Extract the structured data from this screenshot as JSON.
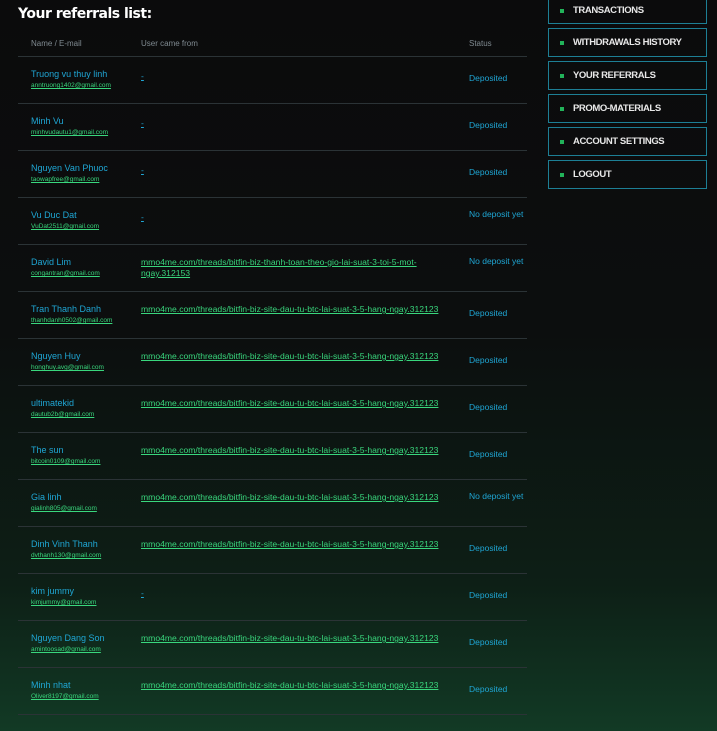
{
  "title": "Your referrals list:",
  "columns": {
    "name": "Name / E-mail",
    "source": "User came from",
    "status": "Status"
  },
  "rows": [
    {
      "name": "Truong vu thuy linh",
      "email": "anntruong1402@gmail.com",
      "source": "-",
      "status": "Deposited"
    },
    {
      "name": "Minh Vu",
      "email": "minhvudautu1@gmail.com",
      "source": "-",
      "status": "Deposited"
    },
    {
      "name": "Nguyen Van Phuoc",
      "email": "taowapfree@gmail.com",
      "source": "-",
      "status": "Deposited"
    },
    {
      "name": "Vu Duc Dat",
      "email": "VuDat2511@gmail.com",
      "source": "-",
      "status": "No deposit yet"
    },
    {
      "name": "David Lim",
      "email": "congantran@gmail.com",
      "source": "mmo4me.com/threads/bitfin-biz-thanh-toan-theo-gio-lai-suat-3-toi-5-mot-ngay.312153",
      "status": "No deposit yet"
    },
    {
      "name": "Tran Thanh Danh",
      "email": "thanhdanh0502@gmail.com",
      "source": "mmo4me.com/threads/bitfin-biz-site-dau-tu-btc-lai-suat-3-5-hang-ngay.312123",
      "status": "Deposited"
    },
    {
      "name": "Nguyen Huy",
      "email": "honghuy.avg@gmail.com",
      "source": "mmo4me.com/threads/bitfin-biz-site-dau-tu-btc-lai-suat-3-5-hang-ngay.312123",
      "status": "Deposited"
    },
    {
      "name": "ultimatekid",
      "email": "dautub2b@gmail.com",
      "source": "mmo4me.com/threads/bitfin-biz-site-dau-tu-btc-lai-suat-3-5-hang-ngay.312123",
      "status": "Deposited"
    },
    {
      "name": "The sun",
      "email": "bitcoin0109@gmail.com",
      "source": "mmo4me.com/threads/bitfin-biz-site-dau-tu-btc-lai-suat-3-5-hang-ngay.312123",
      "status": "Deposited"
    },
    {
      "name": "Gia linh",
      "email": "gialinh805@gmail.com",
      "source": "mmo4me.com/threads/bitfin-biz-site-dau-tu-btc-lai-suat-3-5-hang-ngay.312123",
      "status": "No deposit yet"
    },
    {
      "name": "Dinh Vinh Thanh",
      "email": "dvthanh130@gmail.com",
      "source": "mmo4me.com/threads/bitfin-biz-site-dau-tu-btc-lai-suat-3-5-hang-ngay.312123",
      "status": "Deposited"
    },
    {
      "name": "kim jummy",
      "email": "kimjummy@gmail.com",
      "source": "-",
      "status": "Deposited"
    },
    {
      "name": "Nguyen Dang Son",
      "email": "amintoosad@gmail.com",
      "source": "mmo4me.com/threads/bitfin-biz-site-dau-tu-btc-lai-suat-3-5-hang-ngay.312123",
      "status": "Deposited"
    },
    {
      "name": "Minh nhat",
      "email": "Oliver8197@gmail.com",
      "source": "mmo4me.com/threads/bitfin-biz-site-dau-tu-btc-lai-suat-3-5-hang-ngay.312123",
      "status": "Deposited"
    }
  ],
  "menu": [
    "TRANSACTIONS",
    "WITHDRAWALS HISTORY",
    "YOUR REFERRALS",
    "PROMO-MATERIALS",
    "ACCOUNT SETTINGS",
    "LOGOUT"
  ]
}
